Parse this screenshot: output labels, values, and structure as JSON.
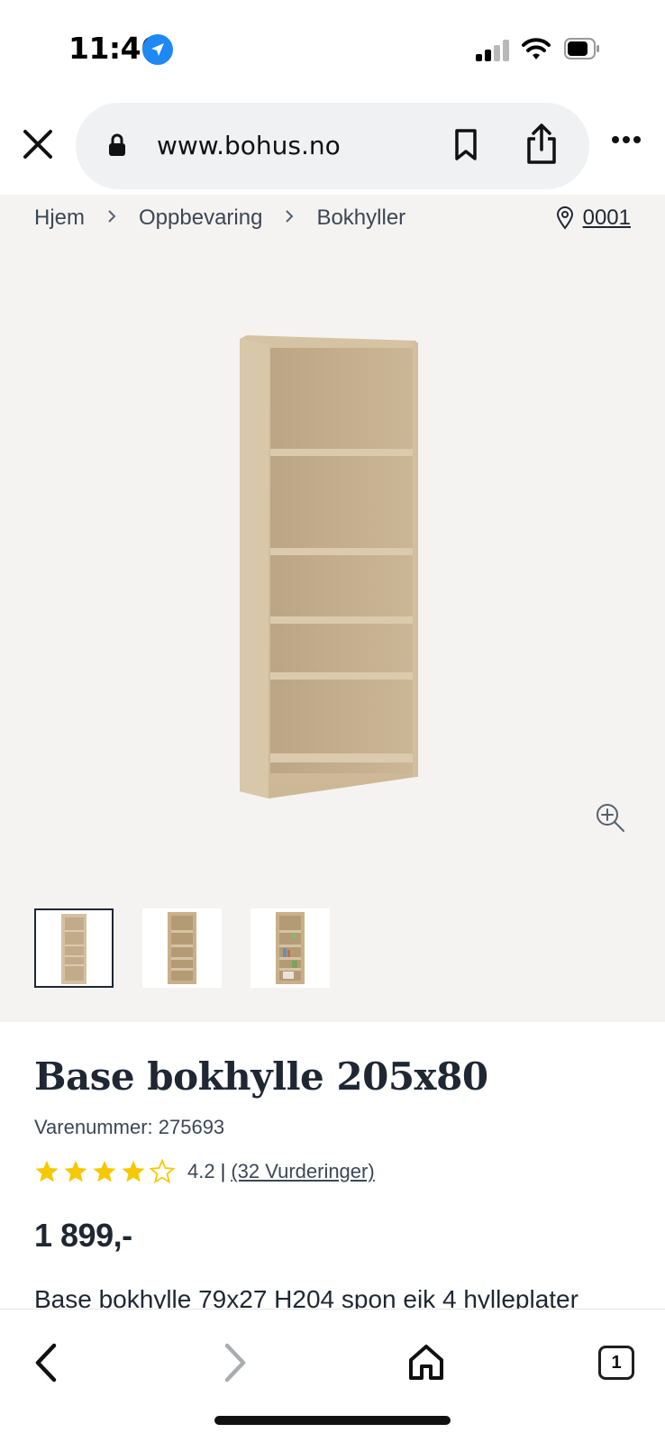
{
  "status": {
    "time": "11:46",
    "icons": [
      "location-arrow-icon",
      "cellular-signal-icon",
      "wifi-icon",
      "battery-icon"
    ]
  },
  "browser": {
    "url": "www.bohus.no",
    "icons": [
      "close-icon",
      "lock-icon",
      "bookmark-icon",
      "share-icon",
      "more-icon"
    ]
  },
  "breadcrumb": {
    "items": [
      "Hjem",
      "Oppbevaring",
      "Bokhyller"
    ],
    "separator": ">",
    "store": "0001"
  },
  "gallery": {
    "thumbnails": 3,
    "selected_index": 0
  },
  "product": {
    "title": "Base bokhylle 205x80",
    "sku_label": "Varenummer: 275693",
    "rating_value": "4.2",
    "rating_separator": "|",
    "reviews_text": "(32 Vurderinger)",
    "stars_filled": 4,
    "stars_total": 5,
    "price": "1 899,-",
    "description": "Base bokhylle 79x27 H204 spon eik 4 hylleplater"
  },
  "toolbar": {
    "tabs_count": "1",
    "icons": [
      "back-icon",
      "forward-icon",
      "home-icon",
      "tabs-icon"
    ]
  },
  "colors": {
    "star": "#f5c800",
    "gallery_bg": "#f5f3f1",
    "text": "#1f2733",
    "location_blue": "#1e88f5"
  }
}
